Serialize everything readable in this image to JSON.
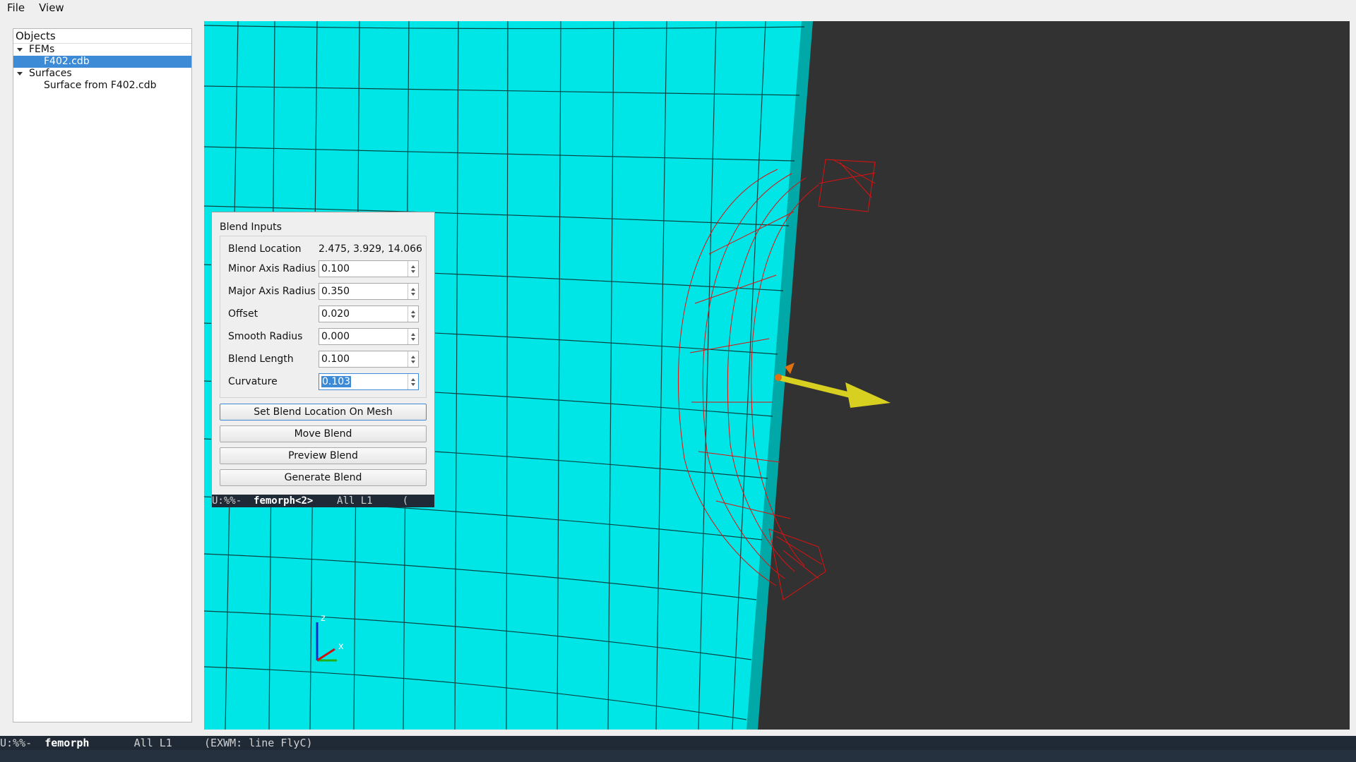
{
  "menubar": {
    "items": [
      "File",
      "View"
    ]
  },
  "tree": {
    "header": "Objects",
    "fems_label": "FEMs",
    "fem_file": "F402.cdb",
    "surfaces_label": "Surfaces",
    "surface_item": "Surface from F402.cdb"
  },
  "viewport": {
    "axis_z": "z",
    "axis_x": "x",
    "colors": {
      "mesh": "#00e5e5",
      "edge": "#009e9e",
      "background": "#323232",
      "wireframe": "#e01010",
      "arrow": "#d8d020",
      "handle": "#e07010"
    }
  },
  "dialog": {
    "title": "Blend Inputs",
    "location_label": "Blend Location",
    "location_value": "2.475, 3.929, 14.066",
    "minor_label": "Minor Axis Radius",
    "minor_value": "0.100",
    "major_label": "Major Axis Radius",
    "major_value": "0.350",
    "offset_label": "Offset",
    "offset_value": "0.020",
    "smooth_label": "Smooth Radius",
    "smooth_value": "0.000",
    "length_label": "Blend Length",
    "length_value": "0.100",
    "curvature_label": "Curvature",
    "curvature_value": "0.103",
    "btn_set_location": "Set Blend Location On Mesh",
    "btn_move": "Move Blend",
    "btn_preview": "Preview Blend",
    "btn_generate": "Generate Blend",
    "modeline_prefix": "U:%%-  ",
    "modeline_buffer": "femorph<2>",
    "modeline_suffix": "    All L1     ("
  },
  "modeline": {
    "prefix": "U:%%-  ",
    "buffer": "femorph",
    "position": "       All L1     ",
    "mode": "(EXWM: line FlyC)"
  }
}
